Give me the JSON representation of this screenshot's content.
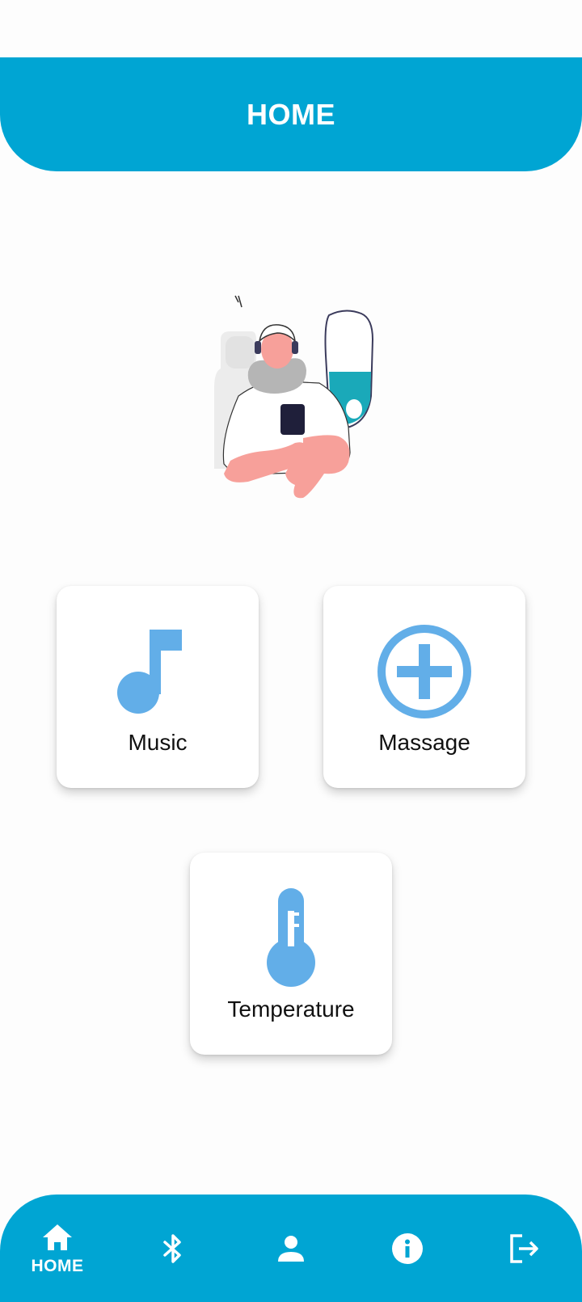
{
  "header": {
    "title": "HOME"
  },
  "illustration": {
    "icon": "person-listening-music-illustration"
  },
  "cards": {
    "music": {
      "label": "Music",
      "icon": "music-note-icon"
    },
    "massage": {
      "label": "Massage",
      "icon": "plus-circle-icon"
    },
    "temperature": {
      "label": "Temperature",
      "icon": "thermometer-icon"
    }
  },
  "bottom_nav": {
    "items": [
      {
        "label": "HOME",
        "icon": "home-icon",
        "active": true
      },
      {
        "label": "",
        "icon": "bluetooth-icon",
        "active": false
      },
      {
        "label": "",
        "icon": "person-icon",
        "active": false
      },
      {
        "label": "",
        "icon": "info-icon",
        "active": false
      },
      {
        "label": "",
        "icon": "logout-icon",
        "active": false
      }
    ]
  },
  "colors": {
    "primary": "#00a5d3",
    "icon_accent": "#62aee8",
    "background": "#fdfdfd",
    "card": "#ffffff"
  }
}
